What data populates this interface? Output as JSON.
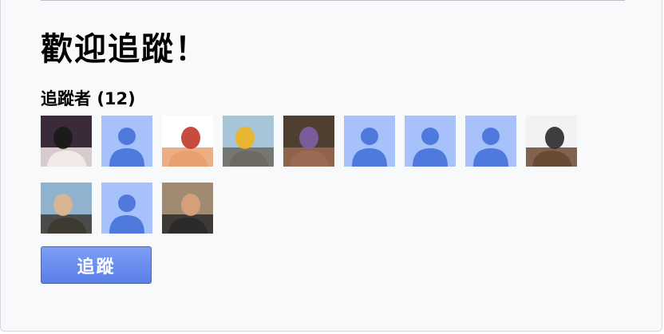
{
  "header": {
    "title": "歡迎追蹤！"
  },
  "followers": {
    "label": "追蹤者",
    "count": "(12)",
    "avatars": [
      {
        "type": "photo",
        "icon": "user-photo-icon",
        "colors": [
          "#3a2a3a",
          "#f2e9e9",
          "#1a1a1a"
        ]
      },
      {
        "type": "default",
        "icon": "default-user-icon",
        "colors": [
          "#a7c2fb",
          "#5079de"
        ]
      },
      {
        "type": "photo",
        "icon": "cartoon-avatar-icon",
        "colors": [
          "#ffffff",
          "#e8a070",
          "#c0392b"
        ]
      },
      {
        "type": "photo",
        "icon": "user-photo-icon",
        "colors": [
          "#a7c4d8",
          "#6d6a62",
          "#f0b51e"
        ]
      },
      {
        "type": "photo",
        "icon": "user-photo-icon",
        "colors": [
          "#4e3f31",
          "#9a6b52",
          "#7f5fa8"
        ]
      },
      {
        "type": "default",
        "icon": "default-user-icon",
        "colors": [
          "#a7c2fb",
          "#5079de"
        ]
      },
      {
        "type": "default",
        "icon": "default-user-icon",
        "colors": [
          "#a7c2fb",
          "#5079de"
        ]
      },
      {
        "type": "default",
        "icon": "default-user-icon",
        "colors": [
          "#a7c2fb",
          "#5079de"
        ]
      },
      {
        "type": "photo",
        "icon": "user-photo-icon",
        "colors": [
          "#f2f2f2",
          "#6b4a34",
          "#2a2a2a"
        ]
      },
      {
        "type": "photo",
        "icon": "user-photo-icon",
        "colors": [
          "#8fb3cf",
          "#3d3a30",
          "#e0b48e"
        ]
      },
      {
        "type": "default",
        "icon": "default-user-icon",
        "colors": [
          "#a7c2fb",
          "#5079de"
        ]
      },
      {
        "type": "photo",
        "icon": "user-photo-icon",
        "colors": [
          "#a08a72",
          "#2b2b2b",
          "#d8a27a"
        ]
      }
    ]
  },
  "actions": {
    "follow_label": "追蹤"
  },
  "colors": {
    "accent": "#5a7fe8",
    "panel_bg": "#f8f9fa",
    "placeholder_bg": "#a7c2fb",
    "placeholder_fg": "#5079de"
  }
}
